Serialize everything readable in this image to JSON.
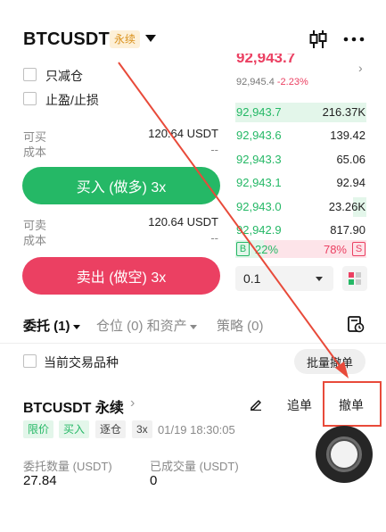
{
  "header": {
    "symbol": "BTCUSDT",
    "badge": "永续"
  },
  "options": {
    "reduce_only": "只减仓",
    "tp_sl": "止盈/止损"
  },
  "buy_panel": {
    "avail_label": "可买",
    "avail_value": "120.64 USDT",
    "cost_label": "成本",
    "cost_value": "--",
    "button": "买入 (做多) 3x"
  },
  "sell_panel": {
    "avail_label": "可卖",
    "avail_value": "120.64 USDT",
    "cost_label": "成本",
    "cost_value": "--",
    "button": "卖出 (做空) 3x"
  },
  "ticker": {
    "last_price": "92,943.7",
    "mark_price": "92,945.4",
    "change": "-2.23%"
  },
  "orderbook": {
    "rows": [
      {
        "price": "92,943.7",
        "qty": "216.37K",
        "depth": 1.0
      },
      {
        "price": "92,943.6",
        "qty": "139.42",
        "depth": 0.0
      },
      {
        "price": "92,943.3",
        "qty": "65.06",
        "depth": 0.0
      },
      {
        "price": "92,943.1",
        "qty": "92.94",
        "depth": 0.0
      },
      {
        "price": "92,943.0",
        "qty": "23.26K",
        "depth": 0.1
      },
      {
        "price": "92,942.9",
        "qty": "817.90",
        "depth": 0.0
      }
    ],
    "ratio": {
      "buy_tag": "B",
      "buy_pct": "22%",
      "sell_pct": "78%",
      "sell_tag": "S",
      "buy_fraction": 0.22
    },
    "depth_value": "0.1"
  },
  "tabs": {
    "orders": "委托 (1)",
    "positions": "仓位 (0) 和资产",
    "strategies": "策略 (0)"
  },
  "filter": {
    "current_symbol": "当前交易品种",
    "batch_cancel": "批量撤单"
  },
  "order": {
    "title": "BTCUSDT 永续",
    "chase": "追单",
    "cancel": "撤单",
    "tags": [
      "限价",
      "买入",
      "逐仓",
      "3x"
    ],
    "time": "01/19 18:30:05",
    "qty_label": "委托数量 (USDT)",
    "qty_value": "27.84",
    "filled_label": "已成交量 (USDT)",
    "filled_value": "0"
  },
  "colors": {
    "green": "#25b866",
    "red": "#eb4062",
    "badge": "#d9901a",
    "annotation": "#e84a3a"
  }
}
